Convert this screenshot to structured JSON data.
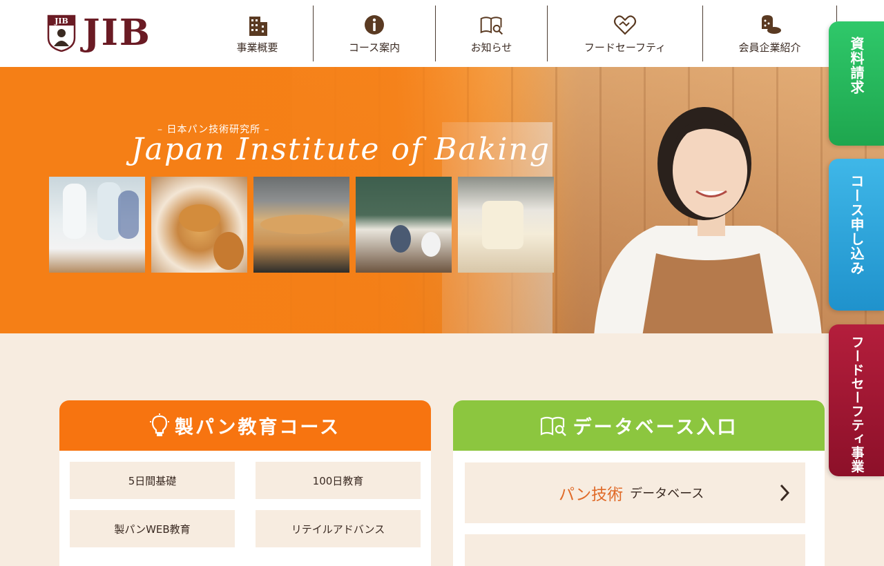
{
  "brand": {
    "logo_text": "JIB",
    "crest_text": "JIB"
  },
  "nav": [
    {
      "label": "事業概要",
      "icon": "building-icon"
    },
    {
      "label": "コース案内",
      "icon": "info-icon"
    },
    {
      "label": "お知らせ",
      "icon": "book-search-icon"
    },
    {
      "label": "フードセーフティ",
      "icon": "heart-handshake-icon"
    },
    {
      "label": "会員企業紹介",
      "icon": "bread-icon"
    }
  ],
  "side_tabs": {
    "document_request": "資料請求",
    "course_apply": "コース申し込み",
    "food_safety": "フードセーフティ事業"
  },
  "hero": {
    "subtitle": "– 日本パン技術研究所 –",
    "title": "Japan Institute of Baking"
  },
  "education_card": {
    "title": "製パン教育コース",
    "courses": [
      "5日間基礎",
      "100日教育",
      "製パンWEB教育",
      "リテイルアドバンス"
    ]
  },
  "database_card": {
    "title": "データベース入口",
    "entries": [
      {
        "main": "パン技術",
        "sub": "データベース"
      }
    ]
  },
  "colors": {
    "brand_maroon": "#6a1b24",
    "orange": "#f77410",
    "green": "#8cc63f",
    "tab_green": "#1ea64e",
    "tab_blue": "#1f92cc",
    "tab_red": "#8c1029"
  }
}
